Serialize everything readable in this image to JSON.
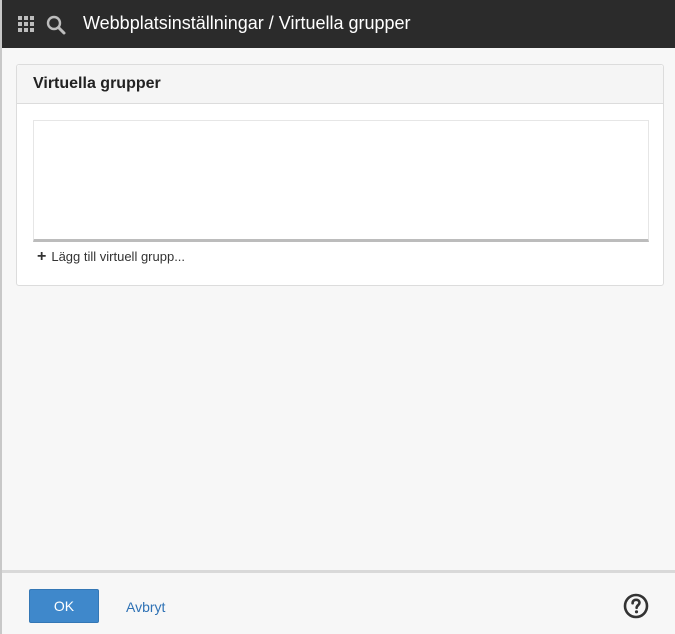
{
  "header": {
    "title": "Webbplatsinställningar / Virtuella grupper",
    "icons": [
      "app-launcher-icon",
      "search-icon"
    ]
  },
  "panel": {
    "title": "Virtuella grupper",
    "items": [],
    "add_label": "Lägg till virtuell grupp..."
  },
  "footer": {
    "ok_label": "OK",
    "cancel_label": "Avbryt",
    "help_icon": "help-icon"
  },
  "colors": {
    "topbar": "#2b2b2b",
    "primary_button": "#3f88cb",
    "link": "#2f72b5",
    "background": "#f7f7f7"
  }
}
